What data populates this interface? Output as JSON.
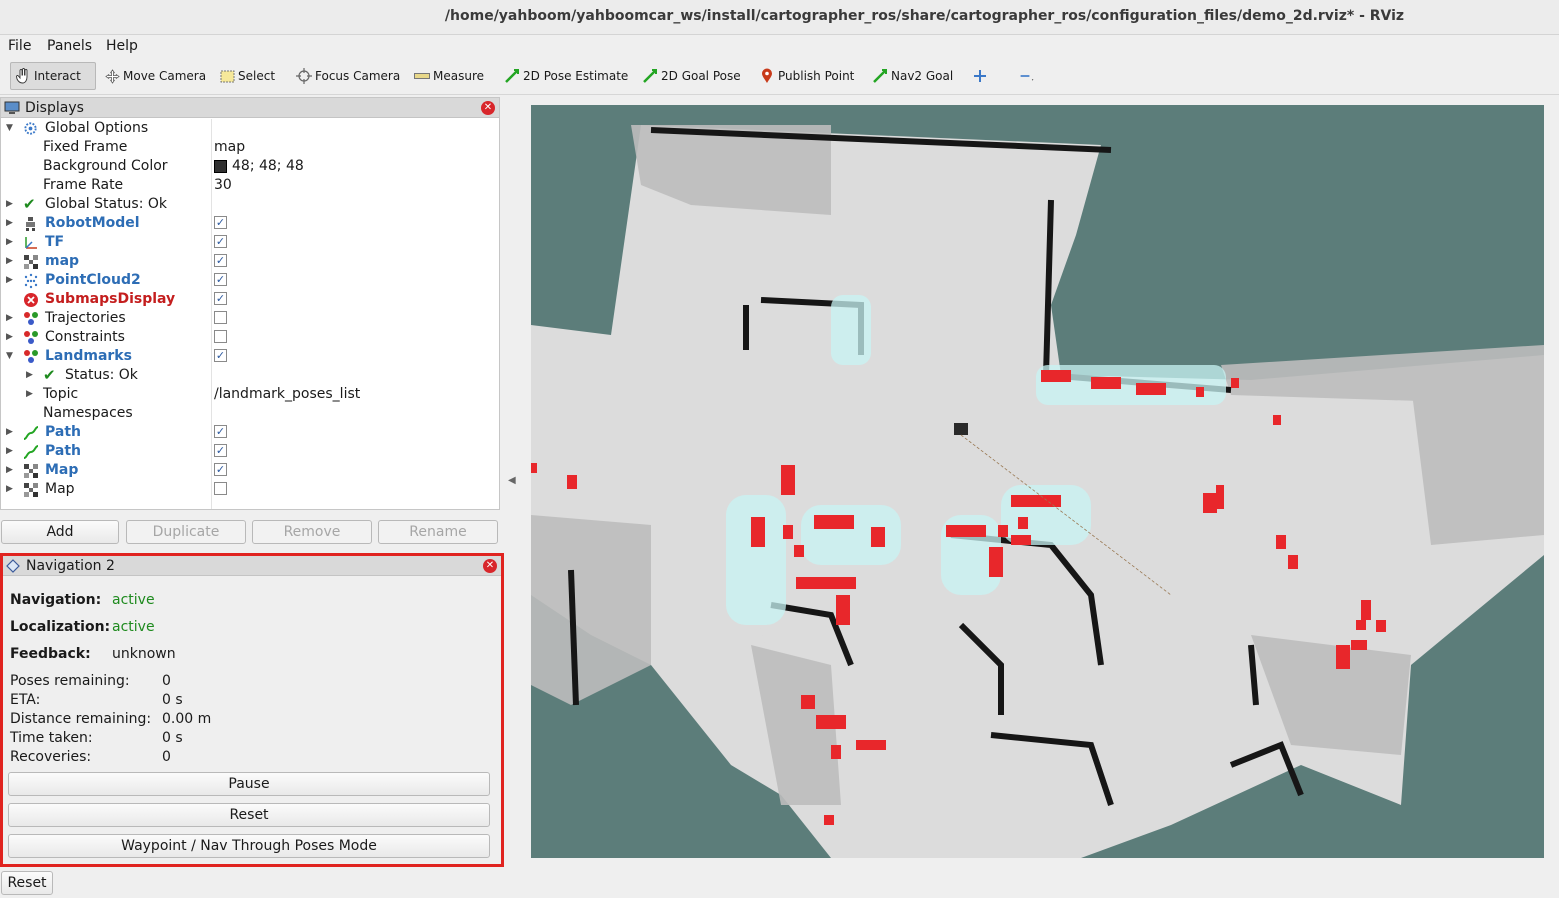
{
  "window": {
    "title": "/home/yahboom/yahboomcar_ws/install/cartographer_ros/share/cartographer_ros/configuration_files/demo_2d.rviz* - RViz"
  },
  "menu": [
    "File",
    "Panels",
    "Help"
  ],
  "toolbar": {
    "interact": "Interact",
    "move_camera": "Move Camera",
    "select": "Select",
    "focus_camera": "Focus Camera",
    "measure": "Measure",
    "pose_estimate": "2D Pose Estimate",
    "goal_pose": "2D Goal Pose",
    "publish_point": "Publish Point",
    "nav2_goal": "Nav2 Goal"
  },
  "displays": {
    "title": "Displays",
    "global_options": "Global Options",
    "fixed_frame_label": "Fixed Frame",
    "fixed_frame_value": "map",
    "bg_color_label": "Background Color",
    "bg_color_value": "48; 48; 48",
    "frame_rate_label": "Frame Rate",
    "frame_rate_value": "30",
    "global_status": "Global Status: Ok",
    "items": [
      {
        "label": "RobotModel",
        "checked": true,
        "style": "blue"
      },
      {
        "label": "TF",
        "checked": true,
        "style": "blue"
      },
      {
        "label": "map",
        "checked": true,
        "style": "blue"
      },
      {
        "label": "PointCloud2",
        "checked": true,
        "style": "blue"
      },
      {
        "label": "SubmapsDisplay",
        "checked": true,
        "style": "red"
      },
      {
        "label": "Trajectories",
        "checked": false,
        "style": "normal"
      },
      {
        "label": "Constraints",
        "checked": false,
        "style": "normal"
      },
      {
        "label": "Landmarks",
        "checked": true,
        "style": "blue"
      }
    ],
    "landmarks_status": "Status: Ok",
    "topic_label": "Topic",
    "topic_value": "/landmark_poses_list",
    "namespaces_label": "Namespaces",
    "items2": [
      {
        "label": "Path",
        "checked": true,
        "style": "blue"
      },
      {
        "label": "Path",
        "checked": true,
        "style": "blue"
      },
      {
        "label": "Map",
        "checked": true,
        "style": "blue"
      },
      {
        "label": "Map",
        "checked": false,
        "style": "normal"
      }
    ],
    "buttons": {
      "add": "Add",
      "duplicate": "Duplicate",
      "remove": "Remove",
      "rename": "Rename"
    }
  },
  "navigation": {
    "title": "Navigation 2",
    "navigation_label": "Navigation:",
    "navigation_value": "active",
    "localization_label": "Localization:",
    "localization_value": "active",
    "feedback_label": "Feedback:",
    "feedback_value": "unknown",
    "poses_remaining_label": "Poses remaining:",
    "poses_remaining_value": "0",
    "eta_label": "ETA:",
    "eta_value": "0 s",
    "distance_label": "Distance remaining:",
    "distance_value": "0.00 m",
    "time_label": "Time taken:",
    "time_value": "0 s",
    "recoveries_label": "Recoveries:",
    "recoveries_value": "0",
    "pause_button": "Pause",
    "reset_button": "Reset",
    "waypoint_button": "Waypoint / Nav Through Poses Mode"
  },
  "footer": {
    "reset": "Reset"
  },
  "colors": {
    "viewport_bg": "#5c7d7a",
    "free_space": "#dedede",
    "obstacle": "#1a1a1a",
    "landmark": "#e8272b",
    "inflation": "#c8f4f4"
  }
}
